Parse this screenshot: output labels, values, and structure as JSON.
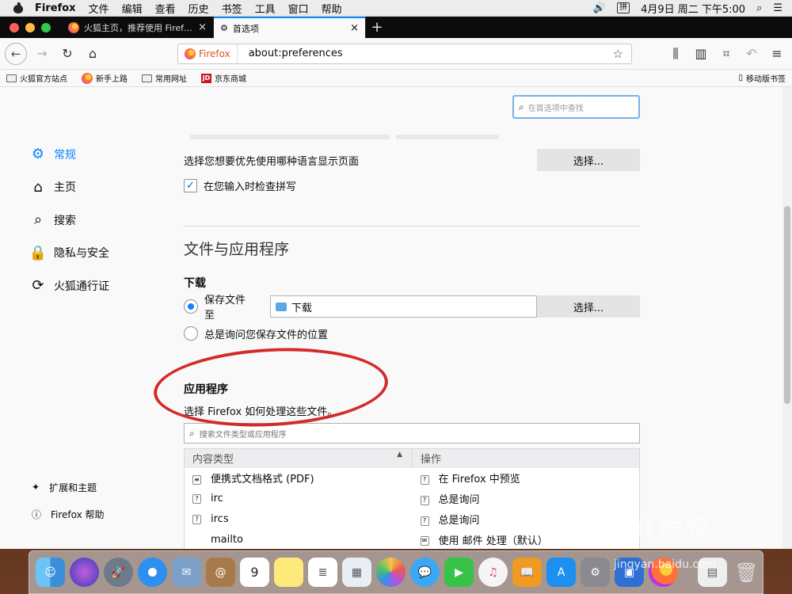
{
  "menubar": {
    "app": "Firefox",
    "items": [
      "文件",
      "编辑",
      "查看",
      "历史",
      "书签",
      "工具",
      "窗口",
      "帮助"
    ],
    "input_method": "拼",
    "datetime": "4月9日 周二 下午5:00"
  },
  "tabs": [
    {
      "title": "火狐主页，推荐使用 Firefox 火狐"
    },
    {
      "title": "首选项"
    }
  ],
  "urlbar": {
    "identity": "Firefox",
    "url": "about:preferences"
  },
  "bookmarks": [
    {
      "label": "火狐官方站点"
    },
    {
      "label": "新手上路"
    },
    {
      "label": "常用网址"
    },
    {
      "label": "京东商城"
    }
  ],
  "mobile_bookmarks": "移动版书签",
  "prefs_search": {
    "placeholder": "在首选项中查找"
  },
  "sidebar": {
    "items": [
      {
        "label": "常规",
        "icon": "gear-icon"
      },
      {
        "label": "主页",
        "icon": "home-icon"
      },
      {
        "label": "搜索",
        "icon": "search-icon"
      },
      {
        "label": "隐私与安全",
        "icon": "lock-icon"
      },
      {
        "label": "火狐通行证",
        "icon": "sync-icon"
      }
    ],
    "bottom": [
      {
        "label": "扩展和主题"
      },
      {
        "label": "Firefox 帮助"
      }
    ]
  },
  "language": {
    "text": "选择您想要优先使用哪种语言显示页面",
    "button": "选择...",
    "spellcheck": "在您输入时检查拼写"
  },
  "files": {
    "heading": "文件与应用程序",
    "downloads_heading": "下载",
    "save_to": "保存文件至",
    "folder": "下载",
    "choose": "选择...",
    "always_ask": "总是询问您保存文件的位置"
  },
  "apps": {
    "heading": "应用程序",
    "desc": "选择 Firefox 如何处理这些文件。",
    "search_placeholder": "搜索文件类型或应用程序",
    "col_type": "内容类型",
    "col_action": "操作",
    "rows": [
      {
        "type": "便携式文档格式 (PDF)",
        "action": "在 Firefox 中预览"
      },
      {
        "type": "irc",
        "action": "总是询问"
      },
      {
        "type": "ircs",
        "action": "总是询问"
      },
      {
        "type": "mailto",
        "action": "使用 邮件 处理（默认）"
      }
    ]
  },
  "watermark": "Bai 经验",
  "watermark_url": "jingyan.baidu.com",
  "dock_calendar_day": "9"
}
